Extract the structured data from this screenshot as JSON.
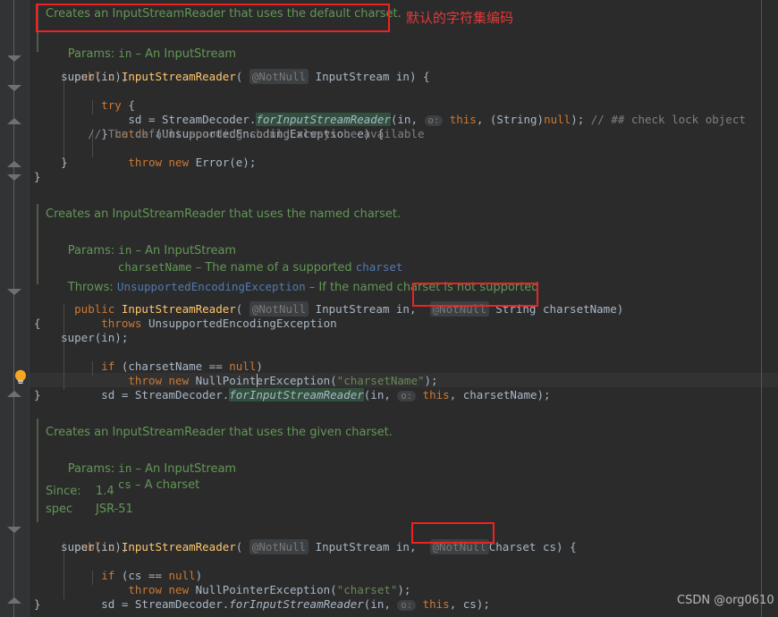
{
  "editor": {
    "background": "#2b2b2b",
    "gutter_background": "#313335",
    "accent_red": "#ee2222",
    "doc_green": "#629755",
    "keyword_orange": "#cc7832"
  },
  "annotations": {
    "chinese_note": "默认的字符集编码",
    "watermark": "CSDN @org0610"
  },
  "doc1": {
    "summary": "Creates an InputStreamReader that uses the default charset.",
    "params_label": "Params:",
    "param_in_name": "in",
    "param_in_dash": " – ",
    "param_in_desc": "An InputStream"
  },
  "code1": {
    "l1_kw": "public ",
    "l1_cls": "InputStreamReader",
    "l1_open": "( ",
    "l1_notnull": "@NotNull",
    "l1_type": " InputStream in) {",
    "l2": "    super(in);",
    "l3_kw": "    try",
    "l3_rest": " {",
    "l4_pre": "        sd = StreamDecoder.",
    "l4_mth": "forInputStreamReader",
    "l4_args_a": "(in, ",
    "l4_hint": "o:",
    "l4_this": " this",
    "l4_args_b": ", (String)",
    "l4_null": "null",
    "l4_args_c": ");",
    "l4_comment": " // ## check lock object",
    "l5_a": "    } ",
    "l5_kw": "catch",
    "l5_b": " (UnsupportedEncodingException e) {",
    "l6_comment": "        // The default encoding should always be available",
    "l7_kw": "        throw new ",
    "l7_rest": "Error(e);",
    "l8": "    }",
    "l9": "}"
  },
  "doc2": {
    "summary": "Creates an InputStreamReader that uses the named charset.",
    "params_label": "Params:",
    "param_in_name": "in",
    "param_in_desc": " – An InputStream",
    "param_cs_name": "charsetName",
    "param_cs_desc": " – The name of a supported ",
    "param_cs_link": "charset",
    "throws_label": "Throws:",
    "throws_type": "UnsupportedEncodingException",
    "throws_desc": " – If the named charset is not supported"
  },
  "code2": {
    "l1_kw": "public ",
    "l1_cls": "InputStreamReader",
    "l1_open": "( ",
    "l1_notnull_a": "@NotNull",
    "l1_mid": " InputStream in,  ",
    "l1_notnull_b": "@NotNull",
    "l1_boxed": " String charsetName",
    "l1_close": ")",
    "l2_kw": "    throws ",
    "l2_rest": "UnsupportedEncodingException",
    "l3": "{",
    "l4": "    super(in);",
    "l5_kw": "    if",
    "l5_mid": " (charsetName == ",
    "l5_null": "null",
    "l5_end": ")",
    "l6_kw": "        throw new ",
    "l6_mid": "NullPointerException(",
    "l6_str": "\"charsetName\"",
    "l6_end": ");",
    "l7_pre": "    sd = StreamDecoder.",
    "l7_mth": "forInputStreamReader",
    "l7_args_a": "(in, ",
    "l7_hint": "o:",
    "l7_this": " this",
    "l7_args_b": ", charsetName);",
    "l8": "}"
  },
  "doc3": {
    "summary": "Creates an InputStreamReader that uses the given charset.",
    "params_label": "Params:",
    "param_in_name": "in",
    "param_in_desc": " – An InputStream",
    "param_cs_name": "cs",
    "param_cs_desc": " – A charset",
    "since_label": "Since:",
    "since_value": "1.4",
    "spec_label": "spec",
    "spec_value": "JSR-51"
  },
  "code3": {
    "l1_kw": "public ",
    "l1_cls": "InputStreamReader",
    "l1_open": "( ",
    "l1_notnull_a": "@NotNull",
    "l1_mid": " InputStream in,  ",
    "l1_notnull_b": "@NotNull",
    "l1_boxed": "Charset cs)",
    "l1_close": " {",
    "l2": "    super(in);",
    "l3_kw": "    if",
    "l3_mid": " (cs == ",
    "l3_null": "null",
    "l3_end": ")",
    "l4_kw": "        throw new ",
    "l4_mid": "NullPointerException(",
    "l4_str": "\"charset\"",
    "l4_end": ");",
    "l5_pre": "    sd = StreamDecoder.",
    "l5_mth": "forInputStreamReader",
    "l5_args_a": "(in, ",
    "l5_hint": "o:",
    "l5_this": " this",
    "l5_args_b": ", cs);",
    "l6": "}"
  }
}
